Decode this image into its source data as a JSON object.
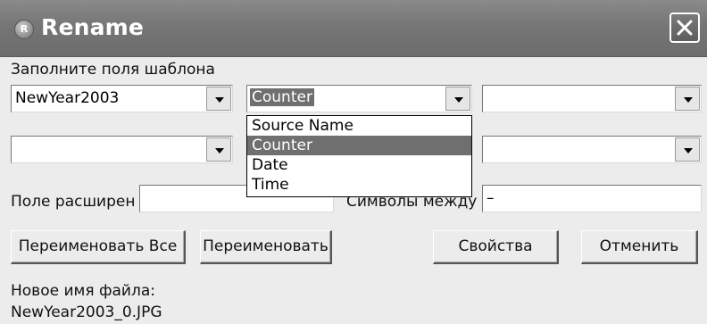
{
  "window": {
    "title": "Rename",
    "app_icon_letter": "R"
  },
  "template_label": "Заполните поля шаблона",
  "fields": {
    "field1": "NewYear2003",
    "field2": "Counter",
    "field3": "",
    "field4": "",
    "field6": ""
  },
  "dropdown": {
    "options": [
      "Source Name",
      "Counter",
      "Date",
      "Time"
    ],
    "selected": "Counter"
  },
  "extension": {
    "label": "Поле расширен",
    "value": ""
  },
  "separator": {
    "label": "Символы между",
    "value": "–"
  },
  "buttons": {
    "rename_all": "Переименовать Все",
    "rename": "Переименовать",
    "properties": "Свойства",
    "cancel": "Отменить"
  },
  "new_name": {
    "label": "Новое имя файла:",
    "value": "NewYear2003_0.JPG"
  }
}
